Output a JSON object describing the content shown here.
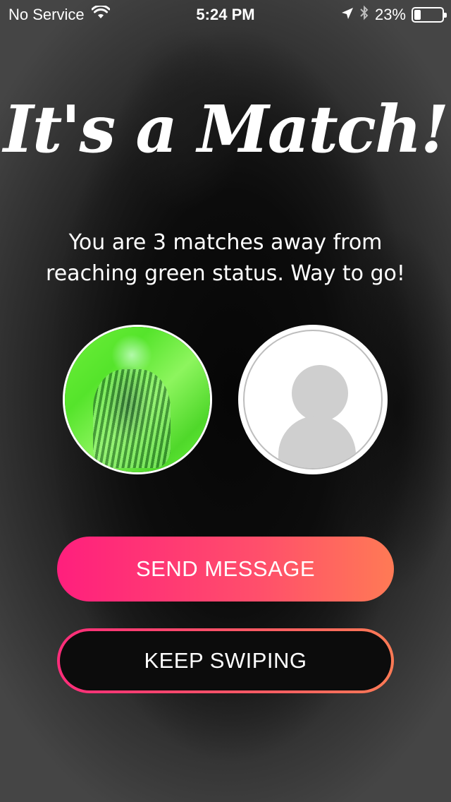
{
  "status_bar": {
    "carrier": "No Service",
    "time": "5:24 PM",
    "battery_percent": "23%",
    "battery_level": 0.23,
    "icons": [
      "wifi-icon",
      "location-arrow-icon",
      "bluetooth-icon",
      "battery-icon"
    ]
  },
  "match": {
    "title": "It's a Match!",
    "subtitle": "You are 3 matches away from reaching green status. Way to go!"
  },
  "avatars": {
    "mine": "user-photo",
    "theirs": "default-profile-icon"
  },
  "actions": {
    "send_message": "SEND MESSAGE",
    "keep_swiping": "KEEP SWIPING"
  },
  "colors": {
    "gradient_start": "#ff1f7d",
    "gradient_end": "#ff7a55"
  }
}
